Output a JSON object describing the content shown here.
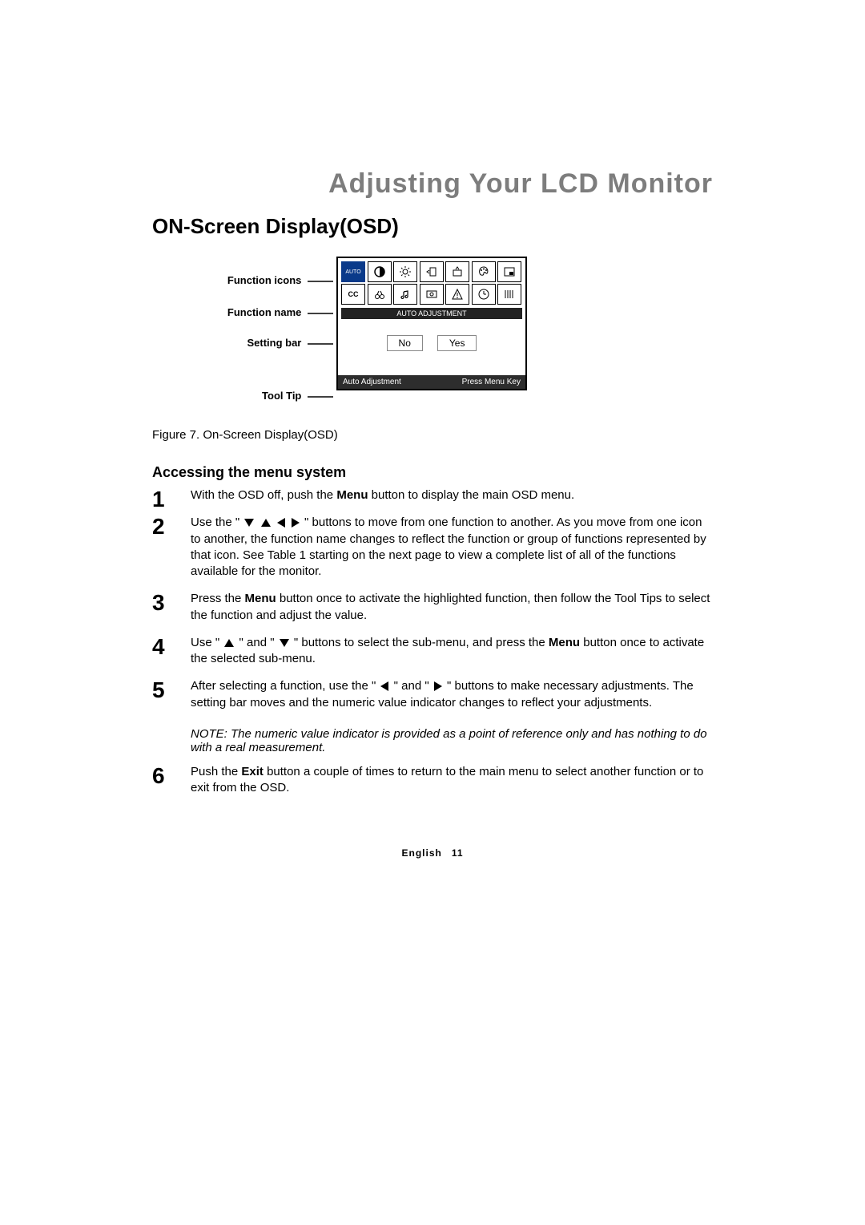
{
  "chapter_title": "Adjusting Your LCD Monitor",
  "section_title": "ON-Screen Display(OSD)",
  "labels": {
    "icons": "Function icons",
    "name": "Function name",
    "bar": "Setting bar",
    "tip": "Tool Tip"
  },
  "osd": {
    "function_name": "AUTO ADJUSTMENT",
    "no": "No",
    "yes": "Yes",
    "tooltip_left": "Auto Adjustment",
    "tooltip_right": "Press Menu Key",
    "auto_label": "AUTO",
    "cc_label": "CC"
  },
  "caption": "Figure 7.  On-Screen Display(OSD)",
  "subhead": "Accessing the menu system",
  "steps": {
    "s1a": "With the OSD off, push the ",
    "s1b": " button to display the main OSD menu.",
    "s2a": "Use the \" ",
    "s2b": " \" buttons to move from one function to another. As you move from one icon to another, the function name changes to reflect the function or group of functions represented by that icon. See Table 1 starting on the next page to view a complete list of all of the functions available for the monitor.",
    "s3a": "Press the ",
    "s3b": " button once to activate the highlighted function, then follow the Tool Tips to select the function and adjust the value.",
    "s4a": "Use \" ",
    "s4b": " \" and \" ",
    "s4c": " \" buttons to select the sub-menu,  and press the ",
    "s4d": " button once to activate the selected sub-menu.",
    "s5a": "After selecting a function, use the \" ",
    "s5b": " \" and \" ",
    "s5c": " \" buttons to make necessary adjustments. The setting bar moves and the numeric value indicator changes to reflect your adjustments.",
    "s6a": "Push the  ",
    "s6b": " button a couple of times to return to the main menu to select another function or to exit from the OSD."
  },
  "kw_menu": "Menu",
  "kw_exit": "Exit",
  "note": "NOTE: The numeric value indicator is provided as a point of reference only and has nothing to do with a real measurement.",
  "footer_lang": "English",
  "footer_page": "11"
}
